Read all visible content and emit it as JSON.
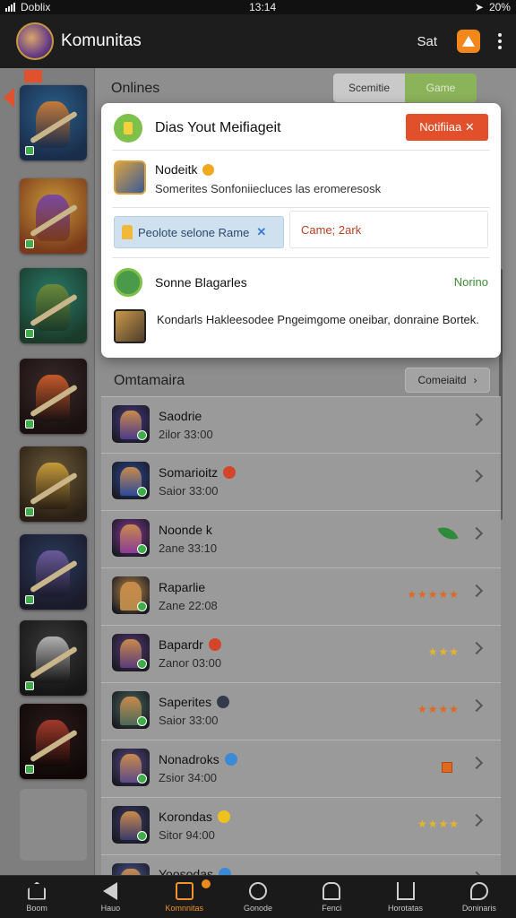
{
  "status_bar": {
    "carrier": "Doblix",
    "time": "13:14",
    "battery": "20%"
  },
  "app_bar": {
    "title": "Komunitas",
    "action_label": "Sat"
  },
  "online": {
    "title": "Onlines",
    "segments": [
      "Scemitie",
      "Game"
    ]
  },
  "popup": {
    "header": "Dias Yout Meifiageit",
    "badge": "Notifiiaa ✕",
    "game_name": "Nodeitk",
    "game_desc": "Somerites Sonfoniiecluces las eromeresosk",
    "pill_label": "Peolote selone Rame",
    "pill_close": "✕",
    "pill2_label": "Came; 2ark",
    "c_name": "Sonne Blagarles",
    "c_status": "Norino",
    "d_text": "Kondarls Hakleesodee Pngeimgome oneibar, donraine Bortek."
  },
  "section": {
    "title": "Omtamaira",
    "button_label": "Comeiaitd"
  },
  "list": [
    {
      "name": "Saodrie",
      "sub": "2ilor 33:00",
      "meta": "none",
      "color": "#4a3a8a",
      "badge": ""
    },
    {
      "name": "Somarioitz",
      "sub": "Saior 33:00",
      "meta": "none",
      "color": "#2a4a9a",
      "badge": "#d2452a"
    },
    {
      "name": "Noonde k",
      "sub": "2ane 33:10",
      "meta": "leaf",
      "color": "#8a3a9a",
      "badge": ""
    },
    {
      "name": "Raparlie",
      "sub": "Zane 22:08",
      "meta": "★★★★★",
      "color": "#b98a4a",
      "badge": ""
    },
    {
      "name": "Bapardr",
      "sub": "Zanor 03:00",
      "meta": "★★★",
      "color": "#5a3a7a",
      "badge": "#d2452a"
    },
    {
      "name": "Saperites",
      "sub": "Saior 33:00",
      "meta": "★★★★",
      "color": "#4a6a5a",
      "badge": "#333a4a"
    },
    {
      "name": "Nonadroks",
      "sub": "Zsior 34:00",
      "meta": "square",
      "color": "#5a4a8a",
      "badge": "#3a8ad5"
    },
    {
      "name": "Korondas",
      "sub": "Sitor 94:00",
      "meta": "★★★★",
      "color": "#3a3a6a",
      "badge": "#f0c020"
    },
    {
      "name": "Yoosodas",
      "sub": "",
      "meta": "none",
      "color": "#4a5a9a",
      "badge": "#3a8ad5"
    }
  ],
  "nav": [
    {
      "label": "Boom",
      "icon": "home-icon"
    },
    {
      "label": "Hauo",
      "icon": "back-icon"
    },
    {
      "label": "Komnnitas",
      "icon": "community-icon"
    },
    {
      "label": "Gonode",
      "icon": "circle-icon"
    },
    {
      "label": "Fenci",
      "icon": "people-icon"
    },
    {
      "label": "Horotatas",
      "icon": "share-icon"
    },
    {
      "label": "Doninaris",
      "icon": "chat-icon"
    }
  ],
  "colors": {
    "accent": "#f0932b",
    "badge_red": "#e1502a",
    "online_green": "#3d8b36"
  }
}
